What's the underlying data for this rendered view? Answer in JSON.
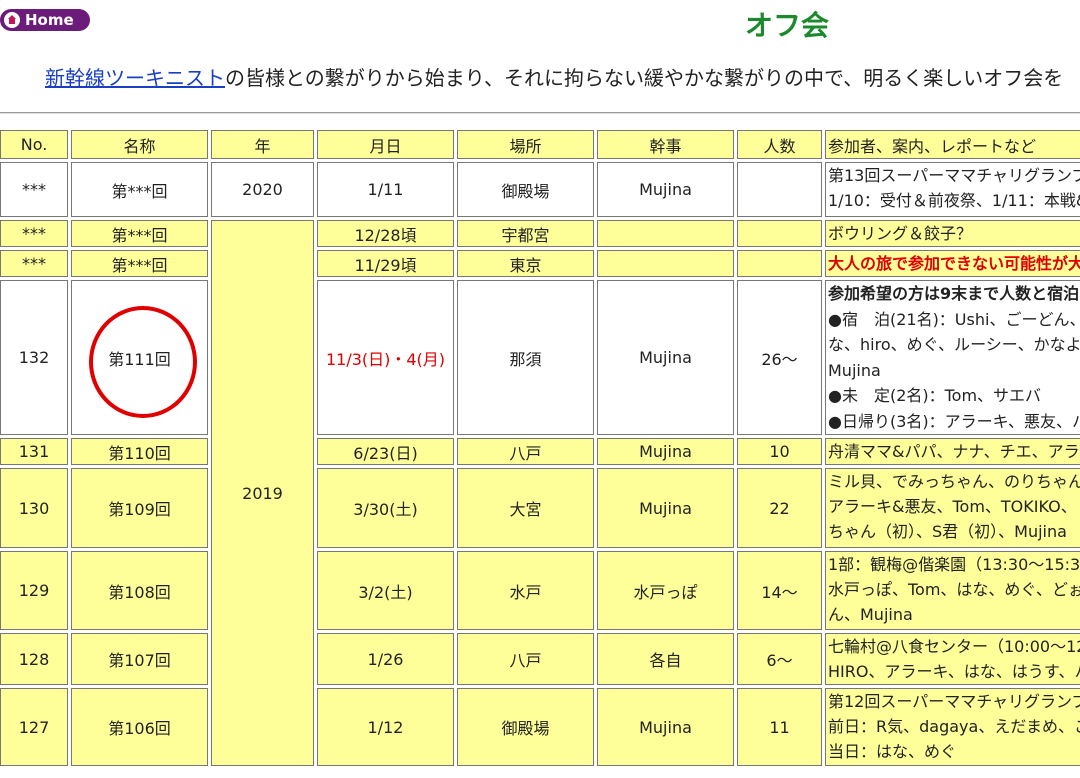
{
  "home": {
    "label": "Home"
  },
  "title": "オフ会",
  "intro": {
    "link": "新幹線ツーキニスト",
    "text": "の皆様との繋がりから始まり、それに拘らない緩やかな繋がりの中で、明るく楽しいオフ会を"
  },
  "table": {
    "headers": [
      "No.",
      "名称",
      "年",
      "月日",
      "場所",
      "幹事",
      "人数",
      "参加者、案内、レポートなど"
    ],
    "rows": [
      {
        "no": "***",
        "name": "第***回",
        "year": "2020",
        "date": "1/11",
        "place": "御殿場",
        "organizer": "Mujina",
        "count": "",
        "notes": [
          "第13回スーパーママチャリグランプ",
          "1/10：受付＆前夜祭、1/11：本戦&"
        ]
      },
      {
        "no": "***",
        "name": "第***回",
        "year": "2019",
        "date": "12/28頃",
        "place": "宇都宮",
        "organizer": "",
        "count": "",
        "notes": [
          "ボウリング＆餃子？"
        ]
      },
      {
        "no": "***",
        "name": "第***回",
        "date": "11/29頃",
        "place": "東京",
        "organizer": "",
        "count": "",
        "notes": [
          "大人の旅で参加できない可能性が大"
        ]
      },
      {
        "no": "132",
        "name": "第111回",
        "date": "11/3(日)・4(月)",
        "place": "那須",
        "organizer": "Mujina",
        "count": "26～",
        "notes": [
          "参加希望の方は9末まで人数と宿泊の",
          "●宿　泊(21名)：Ushi、ごーどん、",
          "な、hiro、めぐ、ルーシー、かなよ",
          "Mujina",
          "●未　定(2名)：Tom、サエバ",
          "●日帰り(3名)：アラーキ、悪友、ハ"
        ]
      },
      {
        "no": "131",
        "name": "第110回",
        "date": "6/23(日)",
        "place": "八戸",
        "organizer": "Mujina",
        "count": "10",
        "notes": [
          "舟清ママ&パパ、ナナ、チエ、アラ"
        ]
      },
      {
        "no": "130",
        "name": "第109回",
        "date": "3/30(土)",
        "place": "大宮",
        "organizer": "Mujina",
        "count": "22",
        "notes": [
          "ミル貝、でみっちゃん、のりちゃん",
          "アラーキ&悪友、Tom、TOKIKO、",
          "ちゃん（初）、S君（初）、Mujina"
        ]
      },
      {
        "no": "129",
        "name": "第108回",
        "date": "3/2(土)",
        "place": "水戸",
        "organizer": "水戸っぽ",
        "count": "14～",
        "notes": [
          "1部：観梅@偕楽園（13:30～15:30",
          "水戸っぽ、Tom、はな、めぐ、どぉ",
          "ん、Mujina"
        ]
      },
      {
        "no": "128",
        "name": "第107回",
        "date": "1/26",
        "place": "八戸",
        "organizer": "各自",
        "count": "6～",
        "notes": [
          "七輪村@八食センター（10:00～12",
          "HIRO、アラーキ、はな、はうす、ハ"
        ]
      },
      {
        "no": "127",
        "name": "第106回",
        "date": "1/12",
        "place": "御殿場",
        "organizer": "Mujina",
        "count": "11",
        "notes": [
          "第12回スーパーママチャリグランプ",
          "前日：R気、dagaya、えだまめ、こ",
          "当日：はな、めぐ"
        ]
      }
    ]
  }
}
